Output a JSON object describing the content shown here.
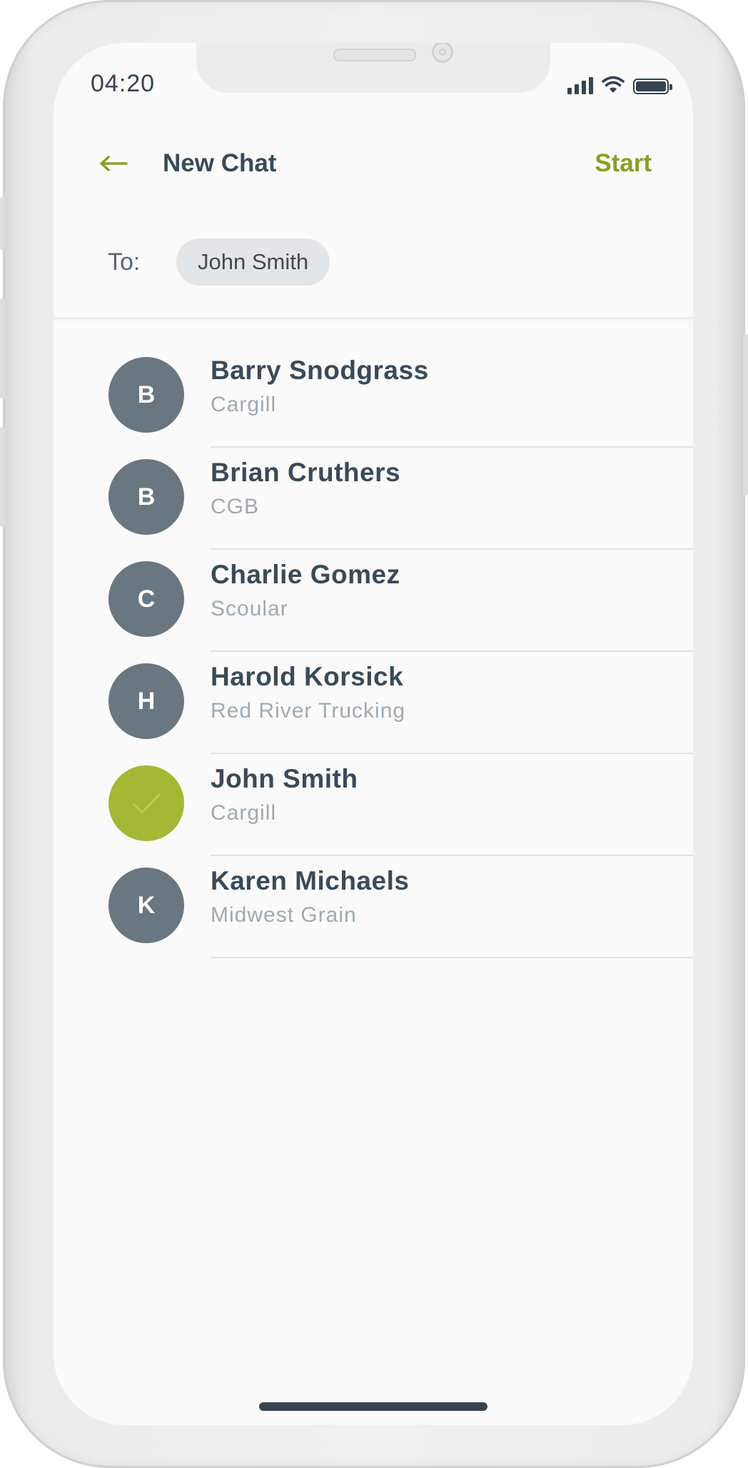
{
  "status_bar": {
    "time": "04:20"
  },
  "header": {
    "title": "New Chat",
    "start_label": "Start",
    "back_icon": "arrow-left-icon"
  },
  "recipient": {
    "to_label": "To:",
    "chip_name": "John Smith"
  },
  "contacts": [
    {
      "initial": "B",
      "name": "Barry Snodgrass",
      "company": "Cargill",
      "selected": false
    },
    {
      "initial": "B",
      "name": "Brian Cruthers",
      "company": "CGB",
      "selected": false
    },
    {
      "initial": "C",
      "name": "Charlie Gomez",
      "company": "Scoular",
      "selected": false
    },
    {
      "initial": "H",
      "name": "Harold Korsick",
      "company": "Red River Trucking",
      "selected": false
    },
    {
      "initial": "",
      "name": "John Smith",
      "company": "Cargill",
      "selected": true
    },
    {
      "initial": "K",
      "name": "Karen Michaels",
      "company": "Midwest Grain",
      "selected": false
    }
  ],
  "colors": {
    "accent": "#8c9f1f",
    "selected_avatar": "#a4b835",
    "avatar": "#6a7780",
    "text": "#3b4a56"
  }
}
